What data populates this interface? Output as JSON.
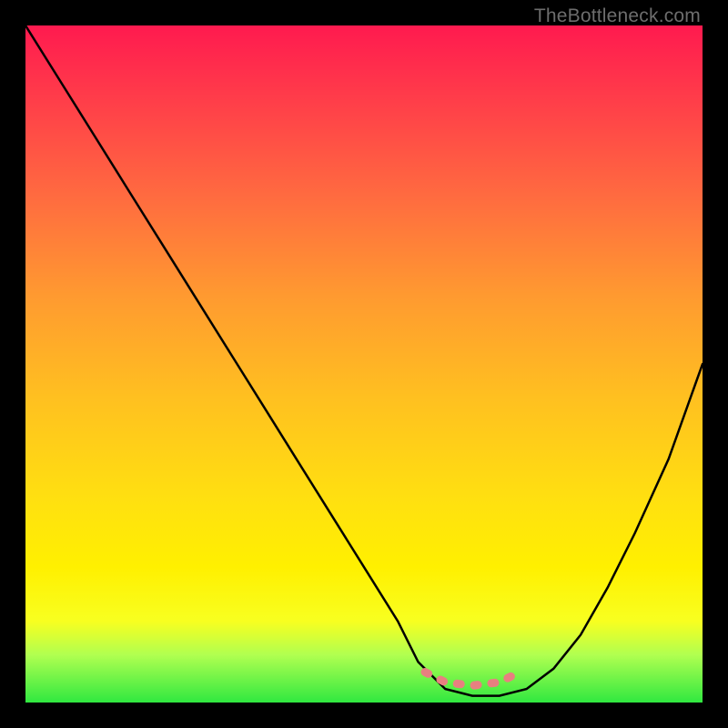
{
  "watermark": "TheBottleneck.com",
  "chart_data": {
    "type": "line",
    "title": "",
    "xlabel": "",
    "ylabel": "",
    "xlim": [
      0,
      100
    ],
    "ylim": [
      0,
      100
    ],
    "series": [
      {
        "name": "bottleneck-curve",
        "x": [
          0,
          5,
          10,
          15,
          20,
          25,
          30,
          35,
          40,
          45,
          50,
          55,
          58,
          62,
          66,
          70,
          74,
          78,
          82,
          86,
          90,
          95,
          100
        ],
        "values": [
          100,
          92,
          84,
          76,
          68,
          60,
          52,
          44,
          36,
          28,
          20,
          12,
          6,
          2,
          1,
          1,
          2,
          5,
          10,
          17,
          25,
          36,
          50
        ]
      },
      {
        "name": "optimal-range-marker",
        "x": [
          59,
          62,
          66,
          70,
          73
        ],
        "values": [
          4.5,
          3,
          2.5,
          3,
          4.5
        ]
      }
    ],
    "optimal_min_x": 59,
    "optimal_max_x": 73,
    "colors": {
      "curve": "#000000",
      "marker": "#e88080"
    }
  }
}
